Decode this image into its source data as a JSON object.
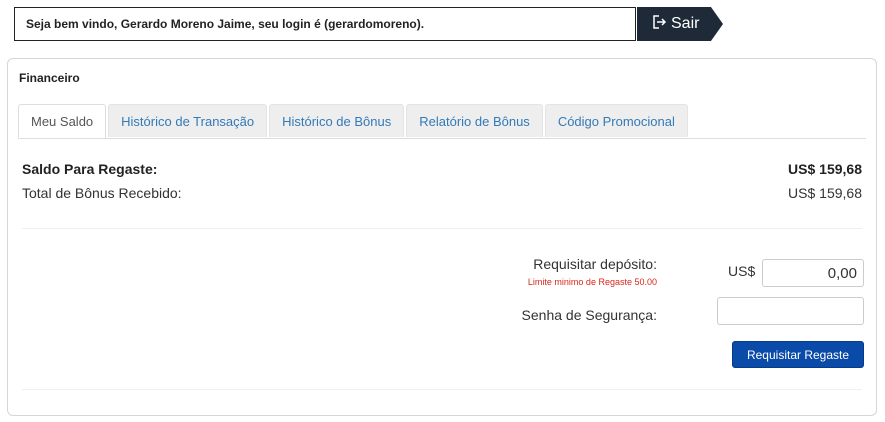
{
  "header": {
    "welcome_text": "Seja bem vindo, Gerardo Moreno Jaime, seu login é (gerardomoreno).",
    "logout_label": "Sair"
  },
  "panel": {
    "title": "Financeiro",
    "tabs": [
      {
        "label": "Meu Saldo",
        "active": true
      },
      {
        "label": "Histórico de Transação",
        "active": false
      },
      {
        "label": "Histórico de Bônus",
        "active": false
      },
      {
        "label": "Relatório de Bônus",
        "active": false
      },
      {
        "label": "Código Promocional",
        "active": false
      }
    ]
  },
  "balance": {
    "redeem_label": "Saldo Para Regaste:",
    "redeem_value": "US$ 159,68",
    "bonus_label": "Total de Bônus Recebido:",
    "bonus_value": "US$ 159,68"
  },
  "form": {
    "deposit_label": "Requisitar depósito:",
    "deposit_hint": "Limite minimo de Regaste 50.00",
    "currency_prefix": "US$",
    "amount_value": "0,00",
    "security_label": "Senha de Segurança:",
    "submit_label": "Requisitar Regaste"
  },
  "colors": {
    "logout_bg": "#1e2a37",
    "tab_link": "#337ab7",
    "hint_red": "#d9261c",
    "submit_bg": "#0a4aa8"
  }
}
